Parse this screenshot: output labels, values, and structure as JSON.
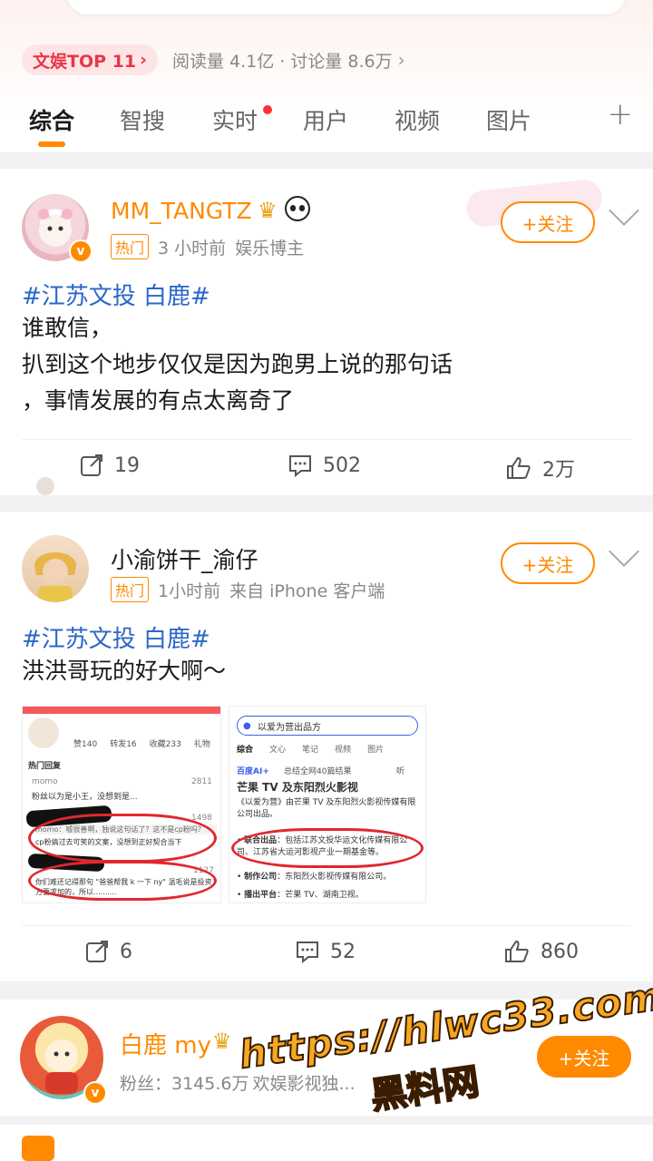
{
  "rank": {
    "badge": "文娱TOP 11",
    "stats": "阅读量 4.1亿 · 讨论量 8.6万"
  },
  "tabs": [
    "综合",
    "智搜",
    "实时",
    "用户",
    "视频",
    "图片"
  ],
  "posts": [
    {
      "username": "MM_TANGTZ",
      "tag": "热门",
      "time": "3 小时前",
      "source": "娱乐博主",
      "follow": "+关注",
      "topic": "#江苏文投 白鹿#",
      "lines": [
        "谁敢信，",
        "扒到这个地步仅仅是因为跑男上说的那句话",
        "，事情发展的有点太离奇了"
      ],
      "reposts": "19",
      "comments": "502",
      "likes": "2万"
    },
    {
      "username": "小渝饼干_渝仔",
      "tag": "热门",
      "time": "1小时前",
      "source": "来自 iPhone 客户端",
      "follow": "+关注",
      "topic": "#江苏文投 白鹿#",
      "lines": [
        "洪洪哥玩的好大啊～"
      ],
      "reposts": "6",
      "comments": "52",
      "likes": "860"
    }
  ],
  "image_left": {
    "stats": [
      "赞140",
      "转发16",
      "收藏233",
      "礼物"
    ],
    "section": "热门回复",
    "c1_user": "momo",
    "c1_text": "粉丝以为是小王，没想到是...",
    "c1_count": "2811",
    "c2_text": "momo：嘘很善啊，独说这句话了？这不是cp粉吗？",
    "c2_count": "1498",
    "c3_text": "cp粉搞过去可笑的文案，没想到正好契合当下",
    "c4_text": "你们难还记得那句 \"爸爸帮我 k 一下 ny\" 温毛说是投资方要求加的，所以..........",
    "c4_count": "1127"
  },
  "image_right": {
    "search": "以爱为营出品方",
    "tabs": [
      "综合",
      "文心",
      "笔记",
      "视频",
      "图片"
    ],
    "ai_line": "总结全网40篇结果",
    "listen": "听",
    "title": "芒果 TV 及东阳烈火影视",
    "p1": "《以爱为营》由芒果 TV 及东阳烈火影视传媒有限公司出品。",
    "p2_label": "联合出品",
    "p2": "：包括江苏文投华运文化传媒有限公司、江苏省大运河影视产业一期基金等。",
    "p3_label": "制作公司",
    "p3": "：东阳烈火影视传媒有限公司。",
    "p4_label": "播出平台",
    "p4": "：芒果 TV、湖南卫视。"
  },
  "user_card": {
    "name": "白鹿 my",
    "fans": "粉丝：3145.6万",
    "desc": "欢娱影视独...",
    "follow": "+关注"
  },
  "watermark": {
    "url": "https://hlwc33.com",
    "name": "黑料网"
  },
  "colors": {
    "accent": "#ff8a00",
    "link": "#2a67c8",
    "hot": "#e8364a"
  }
}
